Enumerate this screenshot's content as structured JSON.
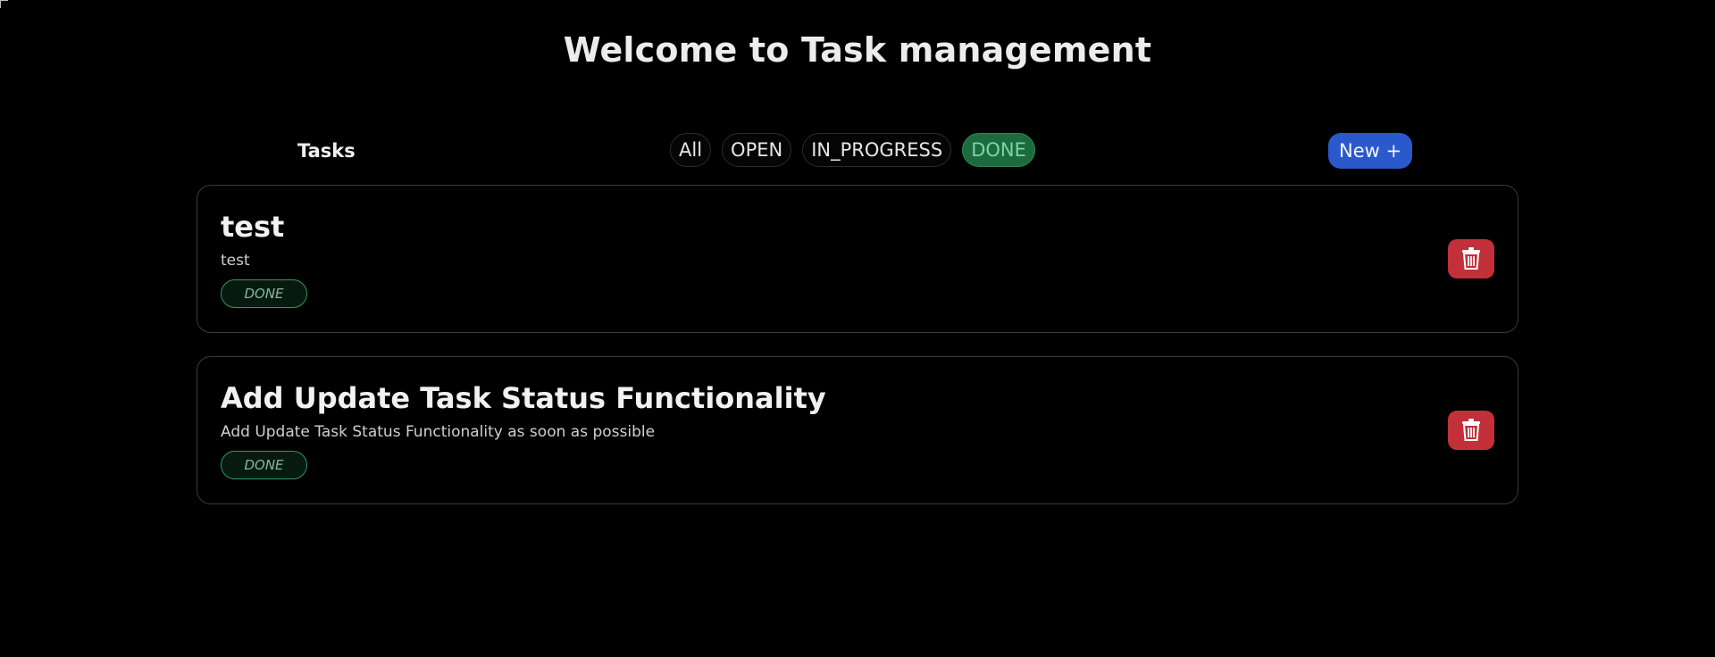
{
  "header": {
    "title": "Welcome to Task management"
  },
  "toolbar": {
    "section_label": "Tasks",
    "filters": [
      {
        "label": "All",
        "active": false
      },
      {
        "label": "OPEN",
        "active": false
      },
      {
        "label": "IN_PROGRESS",
        "active": false
      },
      {
        "label": "DONE",
        "active": true
      }
    ],
    "new_button_label": "New +"
  },
  "tasks": [
    {
      "title": "test",
      "description": "test",
      "status": "DONE"
    },
    {
      "title": "Add Update Task Status Functionality",
      "description": "Add Update Task Status Functionality as soon as possible",
      "status": "DONE"
    }
  ],
  "icons": {
    "delete": "trash-icon"
  },
  "colors": {
    "background": "#000000",
    "accent_blue": "#2a59cc",
    "done_green": "#1c6b3f",
    "delete_red": "#c2303a"
  }
}
